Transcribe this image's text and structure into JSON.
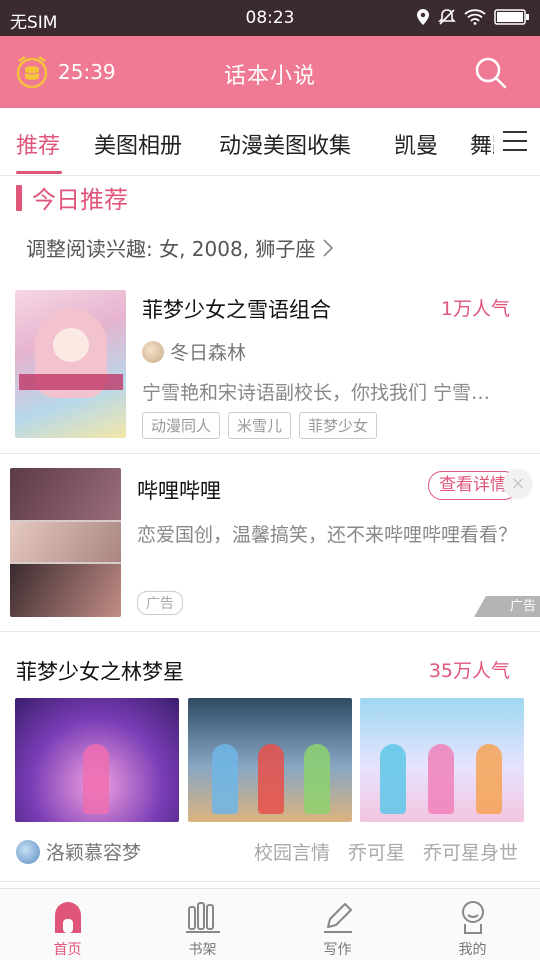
{
  "status_bar": {
    "carrier": "无SIM",
    "time": "08:23"
  },
  "header": {
    "timer": "25:39",
    "title": "话本小说"
  },
  "tabs": [
    "推荐",
    "美图相册",
    "动漫美图收集",
    "凯曼",
    "舞蹈"
  ],
  "section": {
    "title": "今日推荐",
    "interest": "调整阅读兴趣: 女, 2008, 狮子座"
  },
  "book1": {
    "title": "菲梦少女之雪语组合",
    "popularity": "1万人气",
    "author": "冬日森林",
    "description": "宁雪艳和宋诗语副校长，你找我们 宁雪…",
    "tags": [
      "动漫同人",
      "米雪儿",
      "菲梦少女"
    ]
  },
  "ad": {
    "title": "哔哩哔哩",
    "button": "查看详情",
    "close": "×",
    "description": "恋爱国创，温馨搞笑，还不来哔哩哔哩看看？",
    "ad_tag": "广告",
    "corner_label": "广告"
  },
  "book2": {
    "title": "菲梦少女之林梦星",
    "popularity": "35万人气",
    "author": "洛颖慕容梦",
    "tags": [
      "校园言情",
      "乔可星",
      "乔可星身世"
    ]
  },
  "bottom_nav": [
    {
      "label": "首页",
      "icon": "home-icon",
      "active": true
    },
    {
      "label": "书架",
      "icon": "bookshelf-icon",
      "active": false
    },
    {
      "label": "写作",
      "icon": "pen-icon",
      "active": false
    },
    {
      "label": "我的",
      "icon": "profile-icon",
      "active": false
    }
  ],
  "colors": {
    "accent": "#e0557a",
    "header": "#f07a93",
    "status_bar": "#3b2a2e"
  }
}
